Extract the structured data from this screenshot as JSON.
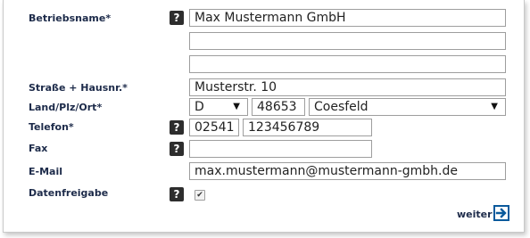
{
  "form": {
    "company": {
      "label": "Betriebsname*",
      "values": [
        "Max Mustermann GmbH",
        "",
        ""
      ],
      "help": "?"
    },
    "street": {
      "label": "Straße + Hausnr.*",
      "value": "Musterstr. 10"
    },
    "location": {
      "label": "Land/Plz/Ort*",
      "country": "D",
      "zip": "48653",
      "city": "Coesfeld"
    },
    "phone": {
      "label": "Telefon*",
      "area_code": "02541",
      "number": "123456789",
      "help": "?"
    },
    "fax": {
      "label": "Fax",
      "value": "",
      "help": "?"
    },
    "email": {
      "label": "E-Mail",
      "value": "max.mustermann@mustermann-gmbh.de"
    },
    "consent": {
      "label": "Datenfreigabe",
      "checked": true,
      "help": "?",
      "check_glyph": "✔"
    }
  },
  "actions": {
    "next_label": "weiter",
    "next_icon": "arrow-right-box-icon"
  },
  "icons": {
    "dropdown": "▼"
  },
  "colors": {
    "label": "#1d2b4a",
    "help_bg": "#2d2d2d",
    "icon_blue": "#0a5a9c"
  }
}
